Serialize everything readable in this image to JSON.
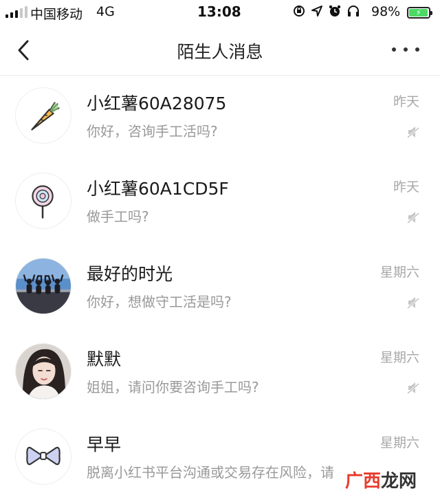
{
  "status_bar": {
    "carrier": "中国移动",
    "network": "4G",
    "time": "13:08",
    "battery_percent": "98%",
    "battery_level": 0.98,
    "icons": [
      "rotation-lock-icon",
      "location-icon",
      "alarm-icon",
      "headphones-icon",
      "battery-charging-icon"
    ]
  },
  "nav": {
    "title": "陌生人消息",
    "back_icon": "chevron-left-icon",
    "more_icon": "more-dots-icon"
  },
  "conversations": [
    {
      "name": "小红薯60A28075",
      "time": "昨天",
      "message": "你好，咨询手工活吗?",
      "avatar": "carrot-avatar",
      "muted": true
    },
    {
      "name": "小红薯60A1CD5F",
      "time": "昨天",
      "message": "做手工吗?",
      "avatar": "lollipop-avatar",
      "muted": true
    },
    {
      "name": "最好的时光",
      "time": "星期六",
      "message": "你好，想做守工活是吗?",
      "avatar": "photo-group-avatar",
      "muted": true
    },
    {
      "name": "默默",
      "time": "星期六",
      "message": "姐姐，请问你要咨询手工吗?",
      "avatar": "photo-portrait-avatar",
      "muted": true
    },
    {
      "name": "早早",
      "time": "星期六",
      "message": "脱离小红书平台沟通或交易存在风险，请",
      "avatar": "bow-avatar",
      "muted": true
    }
  ],
  "watermark": {
    "mark": "广西",
    "text": "龙网"
  },
  "colors": {
    "secondary_text": "#999999",
    "time_text": "#a8a8a8",
    "divider": "#ececec",
    "watermark_accent": "#e83a2c"
  }
}
